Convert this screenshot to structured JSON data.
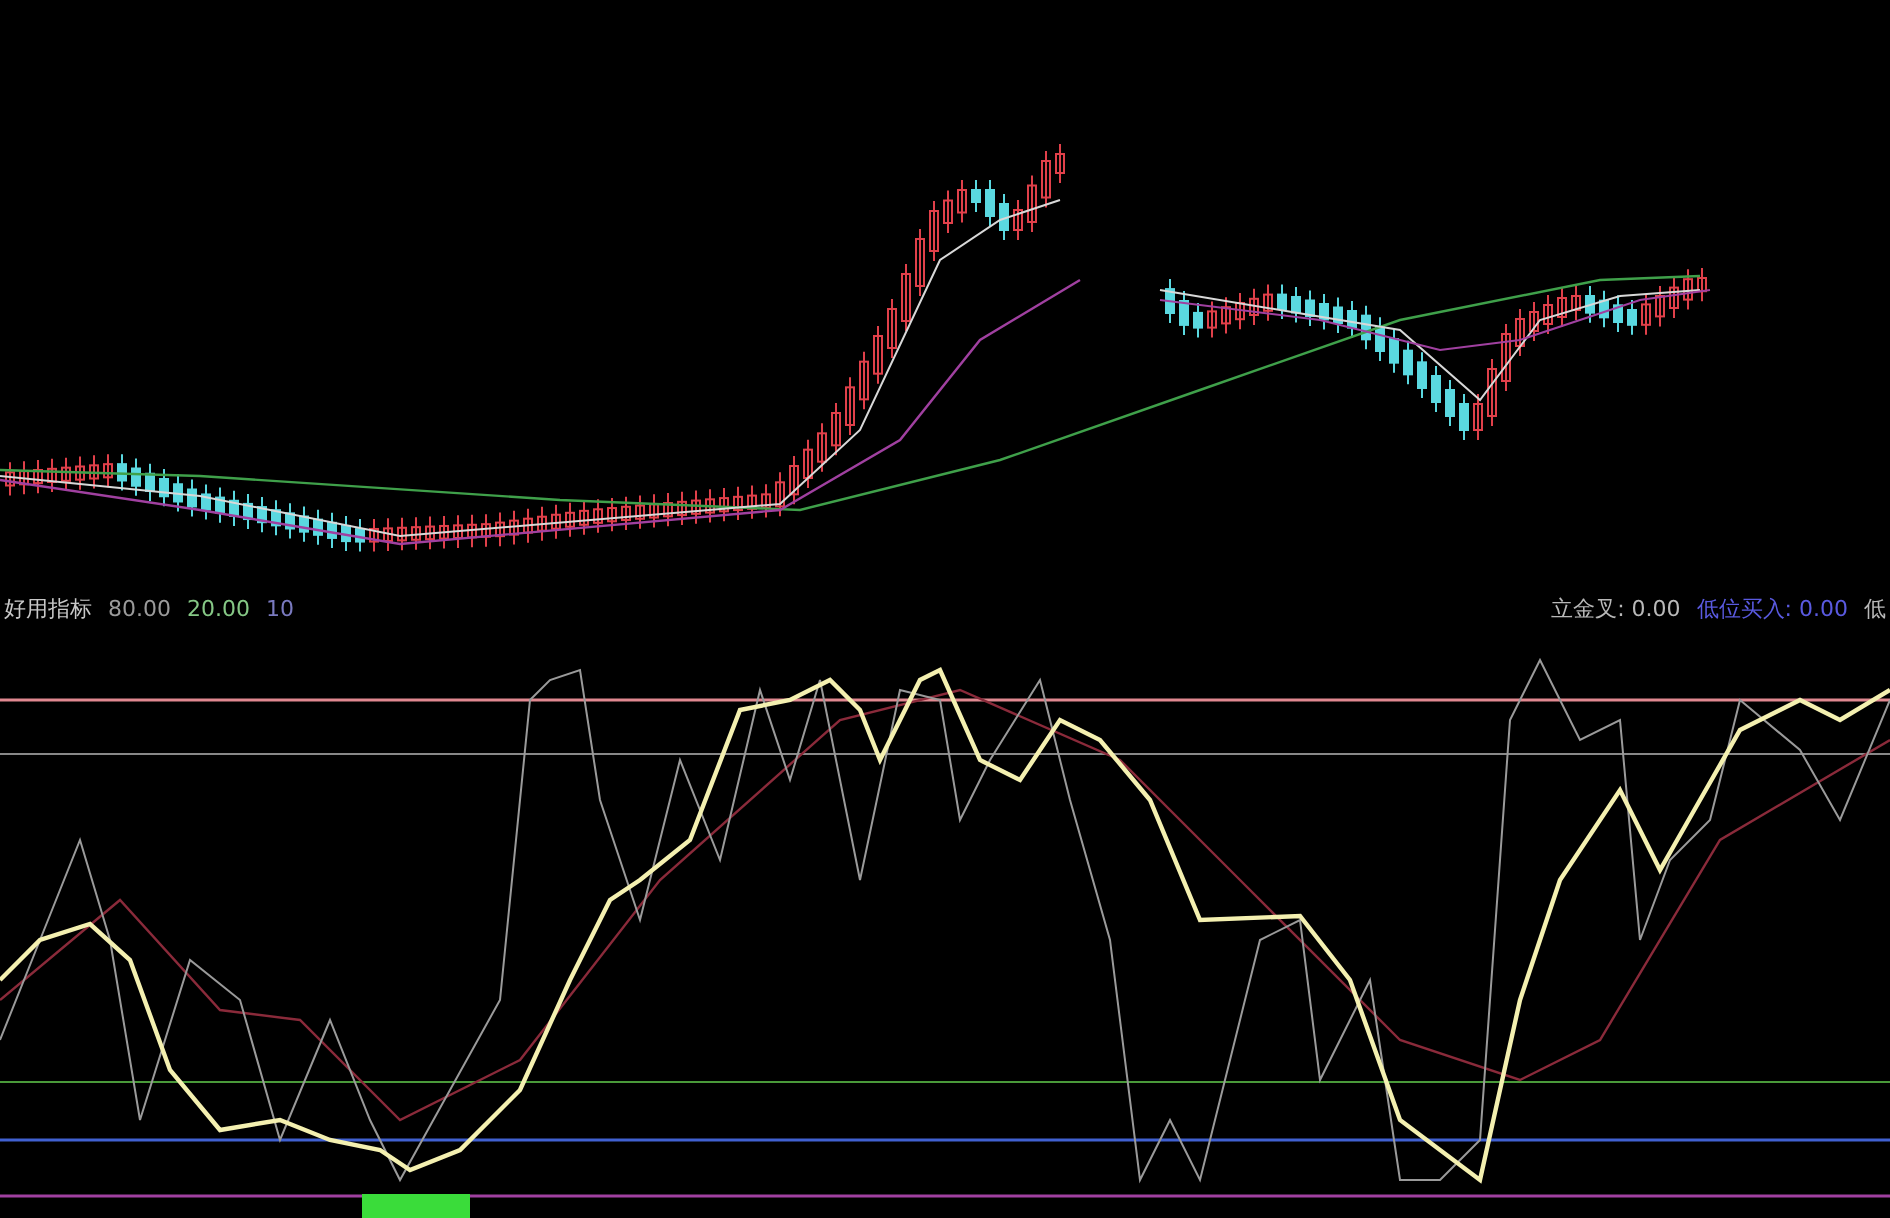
{
  "indicator_legend": {
    "name": "好用指标",
    "values": [
      {
        "text": "80.00",
        "color": "#9a9a9a"
      },
      {
        "text": "20.00",
        "color": "#86c886"
      },
      {
        "text": "10",
        "color": "#7a7ac0"
      }
    ]
  },
  "signals": [
    {
      "text": "立金叉: 0.00",
      "color": "#b8b8b8"
    },
    {
      "text": "低位买入: 0.00",
      "color": "#5a5ae0"
    },
    {
      "text": "低",
      "color": "#b8b8b8"
    }
  ]
}
